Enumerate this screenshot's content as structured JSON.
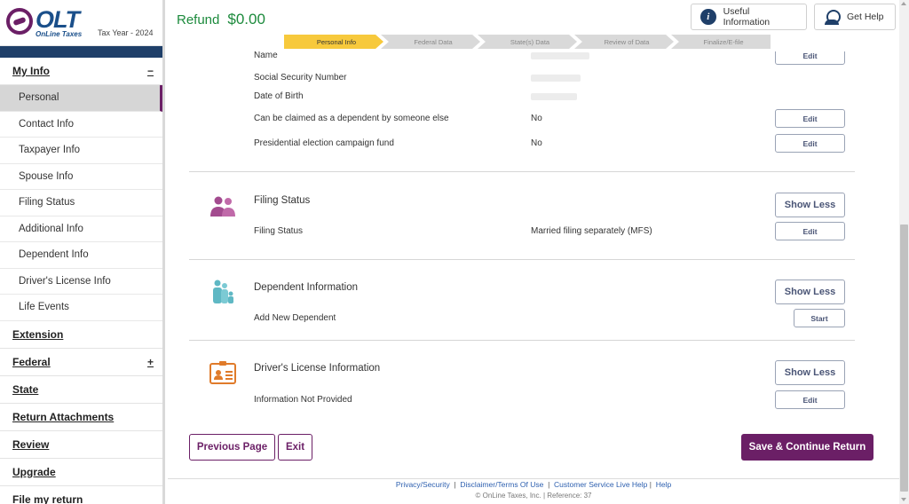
{
  "brand": {
    "logo_text": "OLT",
    "logo_sub": "OnLine Taxes",
    "tax_year": "Tax Year - 2024",
    "accent": "#6b1f66",
    "navy": "#1f3f69",
    "refund_color": "#1c8a3c"
  },
  "sidebar": {
    "my_info": {
      "label": "My Info",
      "sign": "−"
    },
    "items": [
      "Personal",
      "Contact Info",
      "Taxpayer Info",
      "Spouse Info",
      "Filing Status",
      "Additional Info",
      "Dependent Info",
      "Driver's License Info",
      "Life Events"
    ],
    "active_item": "Personal",
    "sections": [
      {
        "label": "Extension",
        "sign": ""
      },
      {
        "label": "Federal",
        "sign": "+"
      },
      {
        "label": "State",
        "sign": ""
      },
      {
        "label": "Return Attachments",
        "sign": ""
      },
      {
        "label": "Review",
        "sign": ""
      },
      {
        "label": "Upgrade",
        "sign": ""
      },
      {
        "label": "File my return",
        "sign": ""
      }
    ]
  },
  "header": {
    "refund_label": "Refund",
    "refund_amount": "$0.00",
    "useful_info_label": "Useful Information",
    "get_help_label": "Get Help",
    "steps": [
      "Personal Info",
      "Federal Data",
      "State(s) Data",
      "Review of Data",
      "Finalize/E-file"
    ],
    "active_step": "Personal Info"
  },
  "personal": {
    "name_label": "Name",
    "ssn_label": "Social Security Number",
    "dob_label": "Date of Birth",
    "dependent_label": "Can be claimed as a dependent by someone else",
    "dependent_value": "No",
    "campaign_label": "Presidential election campaign fund",
    "campaign_value": "No"
  },
  "filing_status": {
    "title": "Filing Status",
    "label": "Filing Status",
    "value": "Married filing separately (MFS)"
  },
  "dependent_info": {
    "title": "Dependent Information",
    "label": "Add New Dependent",
    "start_label": "Start"
  },
  "drivers_license": {
    "title": "Driver's License Information",
    "label": "Information Not Provided"
  },
  "buttons": {
    "edit": "Edit",
    "show_less": "Show Less",
    "previous": "Previous Page",
    "exit": "Exit",
    "save": "Save & Continue Return"
  },
  "footer": {
    "links": [
      "Privacy/Security",
      "Disclaimer/Terms Of Use",
      "Customer Service Live Help",
      "Help"
    ],
    "copyright": "© OnLine Taxes, Inc. | Reference: 37"
  },
  "icons": {
    "useful_info": "info-icon",
    "get_help": "agent-icon",
    "filing_status": "couple-icon",
    "dependent": "family-icon",
    "license": "id-card-icon"
  }
}
